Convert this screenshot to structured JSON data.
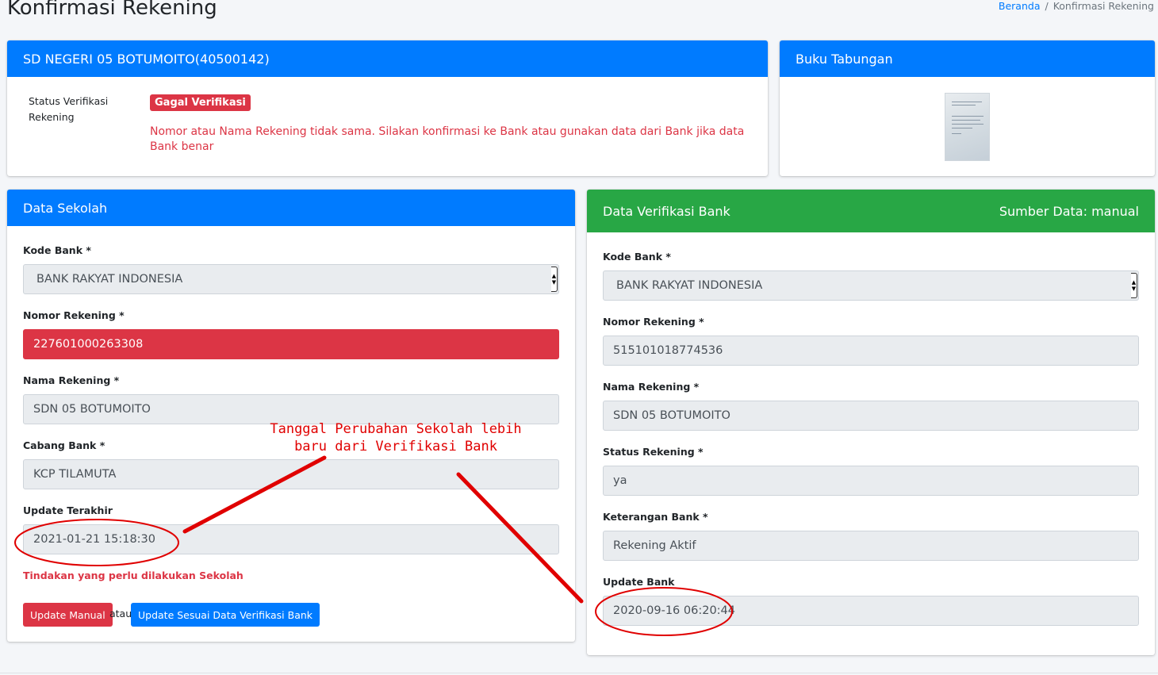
{
  "page": {
    "title": "Konfirmasi Rekening",
    "breadcrumb": {
      "home": "Beranda",
      "separator": "/",
      "current": "Konfirmasi Rekening"
    }
  },
  "school_card": {
    "title": "SD NEGERI 05 BOTUMOITO(40500142)",
    "status_label": "Status Verifikasi Rekening",
    "status_badge": "Gagal Verifikasi",
    "status_message": "Nomor atau Nama Rekening tidak sama. Silakan konfirmasi ke Bank atau gunakan data dari Bank jika data Bank benar"
  },
  "book_card": {
    "title": "Buku Tabungan"
  },
  "data_sekolah": {
    "title": "Data Sekolah",
    "kode_bank_label": "Kode Bank *",
    "kode_bank_value": "BANK RAKYAT INDONESIA",
    "nomor_rekening_label": "Nomor Rekening *",
    "nomor_rekening_value": "227601000263308",
    "nama_rekening_label": "Nama Rekening *",
    "nama_rekening_value": "SDN 05 BOTUMOITO",
    "cabang_bank_label": "Cabang Bank *",
    "cabang_bank_value": "KCP TILAMUTA",
    "update_label": "Update Terakhir",
    "update_value": "2021-01-21 15:18:30",
    "action_note": "Tindakan yang perlu dilakukan Sekolah",
    "btn_manual": "Update Manual",
    "or_text": "atau",
    "btn_sync": "Update Sesuai Data Verifikasi Bank"
  },
  "data_bank": {
    "title": "Data Verifikasi Bank",
    "source": "Sumber Data: manual",
    "kode_bank_label": "Kode Bank *",
    "kode_bank_value": "BANK RAKYAT INDONESIA",
    "nomor_rekening_label": "Nomor Rekening *",
    "nomor_rekening_value": "515101018774536",
    "nama_rekening_label": "Nama Rekening *",
    "nama_rekening_value": "SDN 05 BOTUMOITO",
    "status_rekening_label": "Status Rekening *",
    "status_rekening_value": "ya",
    "keterangan_label": "Keterangan Bank *",
    "keterangan_value": "Rekening Aktif",
    "update_label": "Update Bank",
    "update_value": "2020-09-16 06:20:44"
  },
  "annotation": {
    "line1": "Tanggal Perubahan Sekolah lebih",
    "line2": "baru dari Verifikasi Bank",
    "color": "#e00000"
  },
  "colors": {
    "primary": "#007bff",
    "success": "#28a745",
    "danger": "#dc3545"
  }
}
